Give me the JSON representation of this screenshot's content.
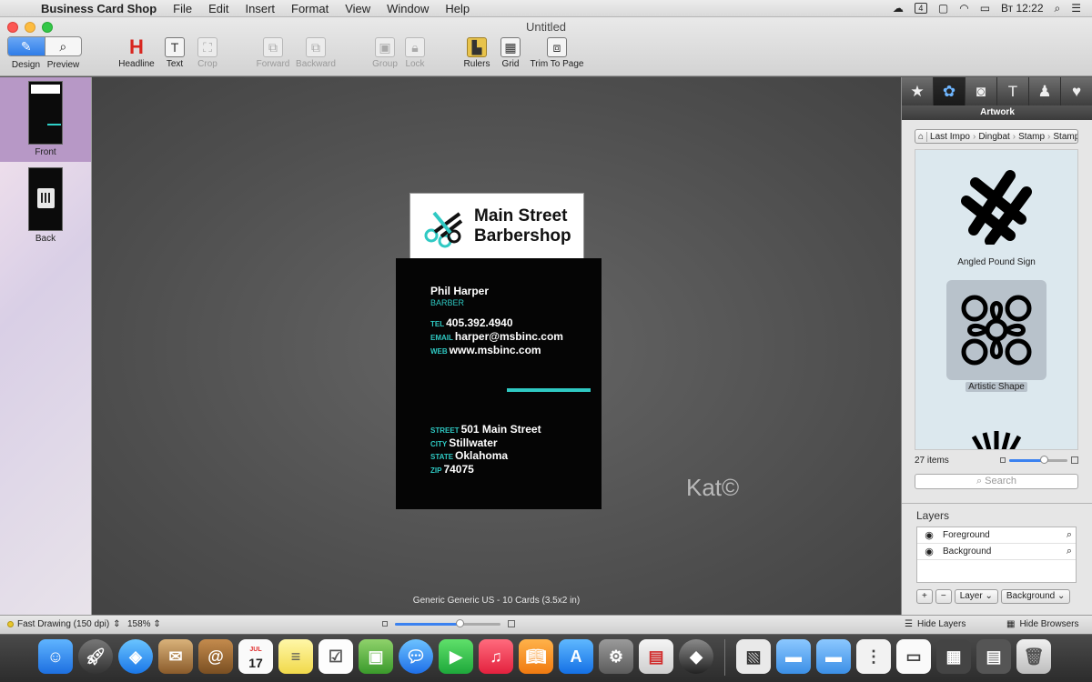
{
  "menubar": {
    "app_name": "Business Card Shop",
    "menus": [
      "File",
      "Edit",
      "Insert",
      "Format",
      "View",
      "Window",
      "Help"
    ],
    "clock": "Вт 12:22",
    "status_badge": "4"
  },
  "window": {
    "title": "Untitled"
  },
  "toolbar": {
    "design_label": "Design",
    "preview_label": "Preview",
    "headline_label": "Headline",
    "text_label": "Text",
    "crop_label": "Crop",
    "forward_label": "Forward",
    "backward_label": "Backward",
    "group_label": "Group",
    "lock_label": "Lock",
    "rulers_label": "Rulers",
    "grid_label": "Grid",
    "trim_label": "Trim To Page"
  },
  "pages": {
    "front_label": "Front",
    "back_label": "Back"
  },
  "card": {
    "brand_line1": "Main Street",
    "brand_line2": "Barbershop",
    "name": "Phil Harper",
    "role": "BARBER",
    "tel_key": "TEL",
    "tel": "405.392.4940",
    "email_key": "EMAIL",
    "email": "harper@msbinc.com",
    "web_key": "WEB",
    "web": "www.msbinc.com",
    "street_key": "STREET",
    "street": "501 Main Street",
    "city_key": "CITY",
    "city": "Stillwater",
    "state_key": "STATE",
    "state": "Oklahoma",
    "zip_key": "ZIP",
    "zip": "74075",
    "accent": "#2fc9c3"
  },
  "canvas": {
    "footer": "Generic Generic US - 10 Cards (3.5x2 in)",
    "watermark": "Kat©"
  },
  "right_panel": {
    "title": "Artwork",
    "tabs": [
      "star-icon",
      "artwork-icon",
      "camera-icon",
      "text-icon",
      "person-icon",
      "heart-icon"
    ],
    "breadcrumbs": [
      "Last Impo",
      "Dingbat",
      "Stamp",
      "Stamp"
    ],
    "items": [
      {
        "caption": "Angled Pound Sign",
        "selected": false
      },
      {
        "caption": "Artistic Shape",
        "selected": true
      }
    ],
    "count": "27 items",
    "search_placeholder": "Search"
  },
  "layers": {
    "title": "Layers",
    "rows": [
      "Foreground",
      "Background"
    ],
    "add_label": "+",
    "remove_label": "−",
    "layer_select": "Layer",
    "layer_value": "Background"
  },
  "statusbar": {
    "quality": "Fast Drawing (150 dpi)",
    "zoom": "158%",
    "hide_layers": "Hide Layers",
    "hide_browsers": "Hide Browsers"
  },
  "dock": {
    "calendar_month": "JUL",
    "calendar_day": "17"
  }
}
